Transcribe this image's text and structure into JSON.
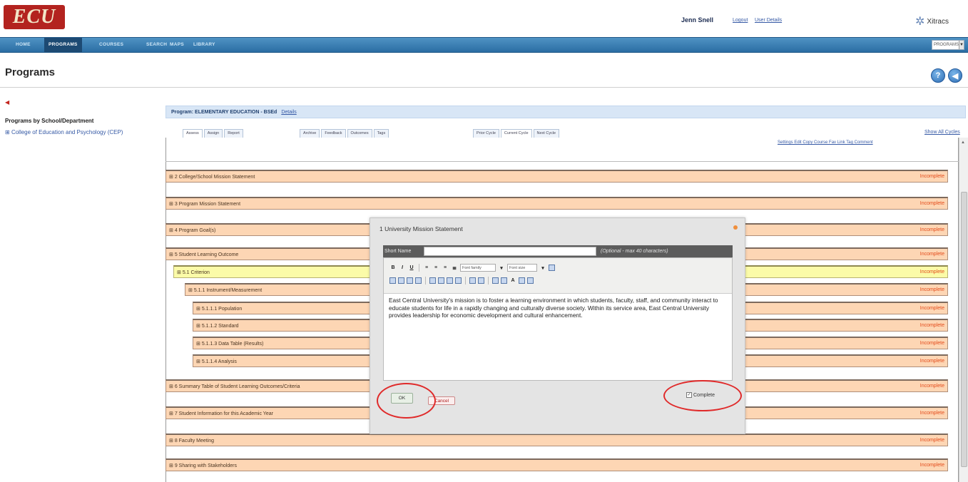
{
  "header": {
    "logo_text": "ECU",
    "user_name": "Jenn Snell",
    "logout_label": "Logout",
    "user_details_label": "User Details",
    "brand": "Xitracs"
  },
  "nav": {
    "items": [
      "HOME",
      "PROGRAMS",
      "COURSES",
      "SEARCH",
      "MAPS",
      "LIBRARY"
    ],
    "active": "PROGRAMS",
    "select_value": "PROGRAMS"
  },
  "page": {
    "title": "Programs"
  },
  "left_panel": {
    "heading": "Programs by School/Department",
    "link": "College of Education and Psychology (CEP)"
  },
  "program": {
    "label": "Program: ELEMENTARY EDUCATION - BSEd",
    "details_label": "Details"
  },
  "tabs": {
    "group1": [
      "Assess",
      "Assign",
      "Report"
    ],
    "group2": [
      "Archive",
      "Feedback",
      "Outcomes",
      "Tags"
    ],
    "group3": [
      "Prior Cycle",
      "Current Cycle",
      "Next Cycle"
    ],
    "active": "Assess"
  },
  "show_all_cycles": "Show All Cycles",
  "actions_text": "Settings Edit Copy Course Fav Link Tag Comment",
  "rows": [
    {
      "text": "2 College/School Mission Statement",
      "status": "Incomplete"
    },
    {
      "text": "3 Program Mission Statement",
      "status": "Incomplete"
    },
    {
      "text": "4 Program Goal(s)",
      "status": "Incomplete"
    },
    {
      "text": "5 Student Learning Outcome",
      "status": "Incomplete"
    },
    {
      "text": "5.1 Criterion",
      "status": "Incomplete"
    },
    {
      "text": "5.1.1 Instrument/Measurement",
      "status": "Incomplete"
    },
    {
      "text": "5.1.1.1 Population",
      "status": "Incomplete"
    },
    {
      "text": "5.1.1.2 Standard",
      "status": "Incomplete"
    },
    {
      "text": "5.1.1.3 Data Table (Results)",
      "status": "Incomplete"
    },
    {
      "text": "5.1.1.4 Analysis",
      "status": "Incomplete"
    },
    {
      "text": "6 Summary Table of Student Learning Outcomes/Criteria",
      "status": "Incomplete"
    },
    {
      "text": "7 Student Information for this Academic Year",
      "status": "Incomplete"
    },
    {
      "text": "8 Faculty Meeting",
      "status": "Incomplete"
    },
    {
      "text": "9 Sharing with Stakeholders",
      "status": "Incomplete"
    }
  ],
  "modal": {
    "title": "1 University Mission Statement",
    "short_name_label": "Short Name",
    "short_name_value": "",
    "short_name_hint": "(Optional - max 40 characters)",
    "font_family": "Font family",
    "font_size": "Font size",
    "body_text": "East Central University's mission is to foster a learning environment in which students, faculty, staff, and community interact to educate students for life in a rapidly changing and culturally diverse society. Within its service area, East Central University provides leadership for economic development and cultural enhancement.",
    "ok_label": "OK",
    "cancel_label": "Cancel",
    "complete_label": "Complete",
    "complete_checked": true
  },
  "colors": {
    "nav_bar": "#2b6da3",
    "row_bg": "#fdd6b4",
    "row_highlight": "#fbfba8",
    "status_incomplete": "#e34b1b",
    "annotation_ring": "#e02a2a"
  }
}
